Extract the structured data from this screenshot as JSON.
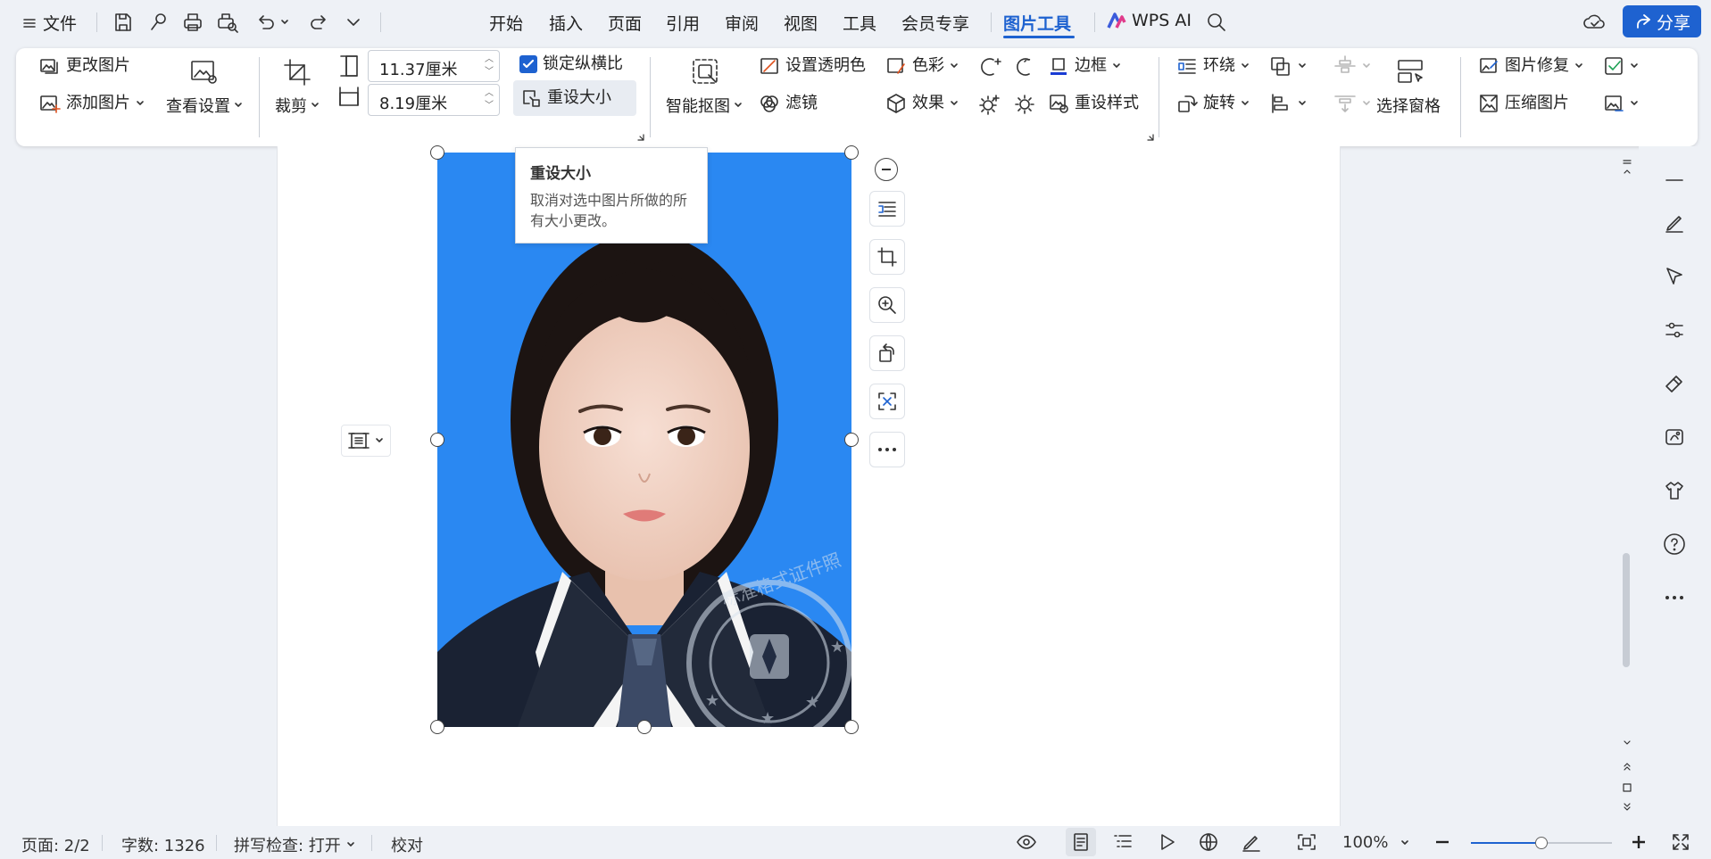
{
  "topbar": {
    "file_label": "文件",
    "tabs": [
      {
        "label": "开始",
        "active": false
      },
      {
        "label": "插入",
        "active": false
      },
      {
        "label": "页面",
        "active": false
      },
      {
        "label": "引用",
        "active": false
      },
      {
        "label": "审阅",
        "active": false
      },
      {
        "label": "视图",
        "active": false
      },
      {
        "label": "工具",
        "active": false
      },
      {
        "label": "会员专享",
        "active": false
      },
      {
        "label": "图片工具",
        "active": true
      }
    ],
    "wps_ai_label": "WPS AI",
    "share_label": "分享",
    "accent_color": "#1e62d0"
  },
  "ribbon": {
    "change_picture": "更改图片",
    "add_picture": "添加图片",
    "view_settings": "查看设置",
    "crop": "裁剪",
    "height_value": "11.37厘米",
    "width_value": "8.19厘米",
    "lock_aspect": "锁定纵横比",
    "lock_aspect_checked": true,
    "reset_size": "重设大小",
    "smart_cutout": "智能抠图",
    "set_transparent": "设置透明色",
    "filter": "滤镜",
    "color": "色彩",
    "effects": "效果",
    "border": "边框",
    "reset_style": "重设样式",
    "wrap": "环绕",
    "rotate": "旋转",
    "selection_pane": "选择窗格",
    "picture_repair": "图片修复",
    "compress_picture": "压缩图片"
  },
  "tooltip": {
    "title": "重设大小",
    "description": "取消对选中图片所做的所有大小更改。"
  },
  "stamp": {
    "text": "标准格式证件照"
  },
  "status": {
    "page": "页面: 2/2",
    "word_count": "字数: 1326",
    "spell_check": "拼写检查: 打开",
    "proofread": "校对",
    "zoom": "100%",
    "zoom_level": 0.5
  }
}
